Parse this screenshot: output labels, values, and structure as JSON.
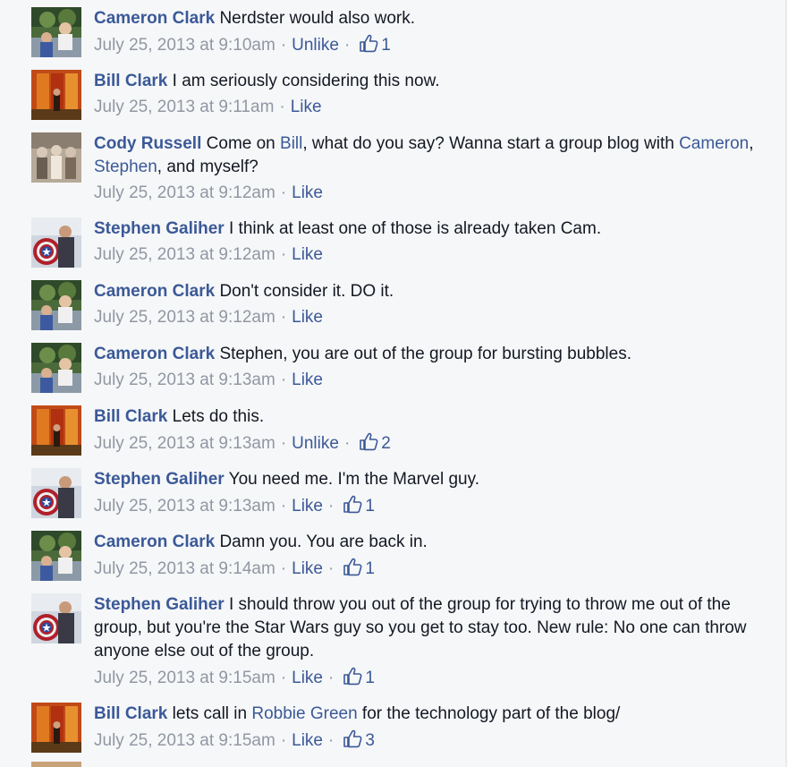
{
  "colors": {
    "link": "#3b5998",
    "text": "#141823",
    "meta": "#9197a3",
    "panel": "#f6f7f8"
  },
  "comments": [
    {
      "author": "Cameron Clark",
      "avatar": "cameron",
      "parts": [
        {
          "t": "Nerdster would also work."
        }
      ],
      "time": "July 25, 2013 at 9:10am",
      "action": "Unlike",
      "likes": "1"
    },
    {
      "author": "Bill Clark",
      "avatar": "bill",
      "parts": [
        {
          "t": "I am seriously considering this now."
        }
      ],
      "time": "July 25, 2013 at 9:11am",
      "action": "Like",
      "likes": ""
    },
    {
      "author": "Cody Russell",
      "avatar": "cody",
      "parts": [
        {
          "t": "Come on "
        },
        {
          "t": "Bill",
          "link": true
        },
        {
          "t": ", what do you say? Wanna start a group blog with "
        },
        {
          "t": "Cameron",
          "link": true
        },
        {
          "t": ", "
        },
        {
          "t": "Stephen",
          "link": true
        },
        {
          "t": ", and myself?"
        }
      ],
      "time": "July 25, 2013 at 9:12am",
      "action": "Like",
      "likes": ""
    },
    {
      "author": "Stephen Galiher",
      "avatar": "stephen",
      "parts": [
        {
          "t": "I think at least one of those is already taken Cam."
        }
      ],
      "time": "July 25, 2013 at 9:12am",
      "action": "Like",
      "likes": ""
    },
    {
      "author": "Cameron Clark",
      "avatar": "cameron",
      "parts": [
        {
          "t": "Don't consider it. DO it."
        }
      ],
      "time": "July 25, 2013 at 9:12am",
      "action": "Like",
      "likes": ""
    },
    {
      "author": "Cameron Clark",
      "avatar": "cameron",
      "parts": [
        {
          "t": "Stephen, you are out of the group for bursting bubbles."
        }
      ],
      "time": "July 25, 2013 at 9:13am",
      "action": "Like",
      "likes": ""
    },
    {
      "author": "Bill Clark",
      "avatar": "bill",
      "parts": [
        {
          "t": "Lets do this."
        }
      ],
      "time": "July 25, 2013 at 9:13am",
      "action": "Unlike",
      "likes": "2"
    },
    {
      "author": "Stephen Galiher",
      "avatar": "stephen",
      "parts": [
        {
          "t": "You need me. I'm the Marvel guy."
        }
      ],
      "time": "July 25, 2013 at 9:13am",
      "action": "Like",
      "likes": "1"
    },
    {
      "author": "Cameron Clark",
      "avatar": "cameron",
      "parts": [
        {
          "t": "Damn you. You are back in."
        }
      ],
      "time": "July 25, 2013 at 9:14am",
      "action": "Like",
      "likes": "1"
    },
    {
      "author": "Stephen Galiher",
      "avatar": "stephen",
      "parts": [
        {
          "t": "I should throw you out of the group for trying to throw me out of the group, but you're the Star Wars guy so you get to stay too. New rule: No one can throw anyone else out of the group."
        }
      ],
      "time": "July 25, 2013 at 9:15am",
      "action": "Like",
      "likes": "1"
    },
    {
      "author": "Bill Clark",
      "avatar": "bill",
      "parts": [
        {
          "t": "lets call in "
        },
        {
          "t": "Robbie Green",
          "link": true
        },
        {
          "t": " for the technology part of the blog/"
        }
      ],
      "time": "July 25, 2013 at 9:15am",
      "action": "Like",
      "likes": "3"
    }
  ]
}
